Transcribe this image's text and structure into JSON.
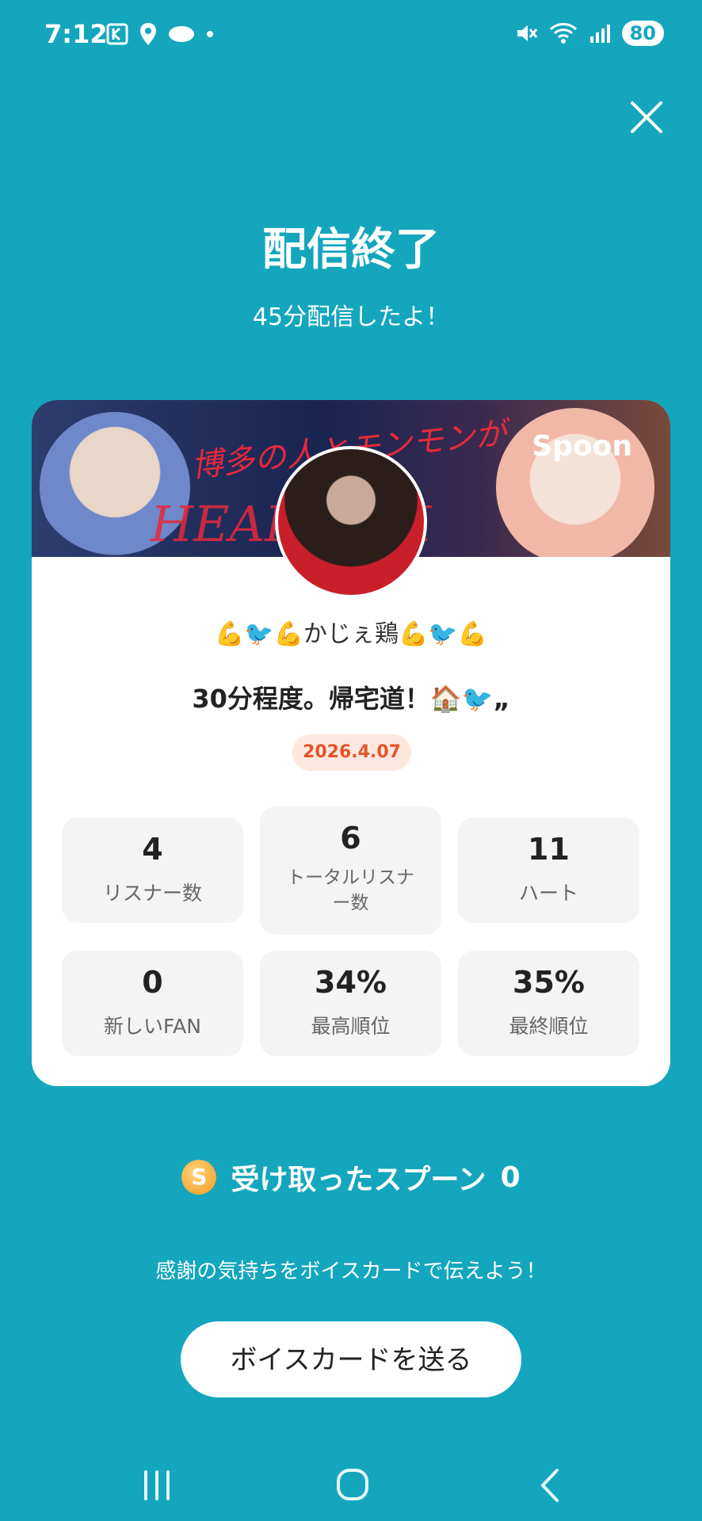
{
  "status_bar": {
    "time": "7:12",
    "battery": "80"
  },
  "header": {
    "title": "配信終了",
    "subtitle": "45分配信したよ！"
  },
  "card": {
    "brand": "Spoon",
    "banner_text_1": "博多の人とモンモンが",
    "banner_text_2": "HEAD   ACK",
    "streamer_name": "💪🐦💪かじぇ鶏💪🐦💪",
    "live_title": "30分程度。帰宅道！🏠🐦„",
    "date": "2026.4.07",
    "stats": [
      {
        "value": "4",
        "label": "リスナー数"
      },
      {
        "value": "6",
        "label": "トータルリスナー数"
      },
      {
        "value": "11",
        "label": "ハート"
      },
      {
        "value": "0",
        "label": "新しいFAN"
      },
      {
        "value": "34%",
        "label": "最高順位"
      },
      {
        "value": "35%",
        "label": "最終順位"
      }
    ]
  },
  "spoons": {
    "coin_letter": "S",
    "label": "受け取ったスプーン",
    "count": "0"
  },
  "thanks_text": "感謝の気持ちをボイスカードで伝えよう！",
  "voice_card_button": "ボイスカードを送る",
  "colors": {
    "background": "#13a6bd",
    "accent": "#e5542a"
  }
}
